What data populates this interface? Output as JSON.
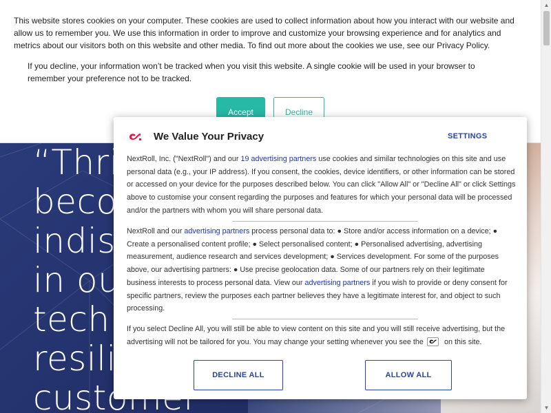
{
  "cookie_banner": {
    "text1": "This website stores cookies on your computer. These cookies are used to collect information about how you interact with our website and allow us to remember you. We use this information in order to improve and customize your browsing experience and for analytics and metrics about our visitors both on this website and other media. To find out more about the cookies we use, see our Privacy Policy.",
    "text2": "If you decline, your information won’t be tracked when you visit this website. A single cookie will be used in your browser to remember your preference not to be tracked.",
    "accept_label": "Accept",
    "decline_label": "Decline"
  },
  "hero": {
    "quote_lines": [
      "“Thriv",
      "becom",
      "indisp",
      "in our",
      "techn",
      "resilie",
      "customer"
    ]
  },
  "modal": {
    "title": "We Value Your Privacy",
    "settings_label": "SETTINGS",
    "p1": {
      "pre": "NextRoll, Inc. (\"NextRoll\") and our ",
      "link": "19 advertising partners",
      "post": " use cookies and similar technologies on this site and use personal data (e.g., your IP address). If you consent, the cookies, device identifiers, or other information can be stored or accessed on your device for the purposes described below. You can click \"Allow All\" or \"Decline All\" or click Settings above to customise your consent regarding the purposes and features for which your personal data will be processed and/or the partners with whom you will share personal data."
    },
    "p2": {
      "pre": "NextRoll and our ",
      "link1": "advertising partners",
      "mid": " process personal data to: ● Store and/or access information on a device; ● Create a personalised content profile; ● Select personalised content; ● Personalised advertising, advertising measurement, audience research and services development; ● Services development. For some of the purposes above, our advertising partners: ● Use precise geolocation data. Some of our partners rely on their legitimate business interests to process personal data. View our ",
      "link2": "advertising partners",
      "post": " if you wish to provide or deny consent for specific partners, review the purposes each partner believes they have a legitimate interest for, and object to such processing."
    },
    "p3": {
      "pre": "If you select Decline All, you will still be able to view content on this site and you will still receive advertising, but the advertising will not be tailored for you. You may change your setting whenever you see the",
      "post": "on this site."
    },
    "decline_all_label": "DECLINE ALL",
    "allow_all_label": "ALLOW ALL"
  },
  "colors": {
    "accent_teal": "#27b8a6",
    "link_blue": "#2843a8",
    "logo_red": "#e5164a",
    "hero_navy": "#23306a"
  },
  "icons": {
    "modal_logo": "nextroll-logo-icon",
    "inline_logo": "nextroll-small-logo-icon"
  }
}
